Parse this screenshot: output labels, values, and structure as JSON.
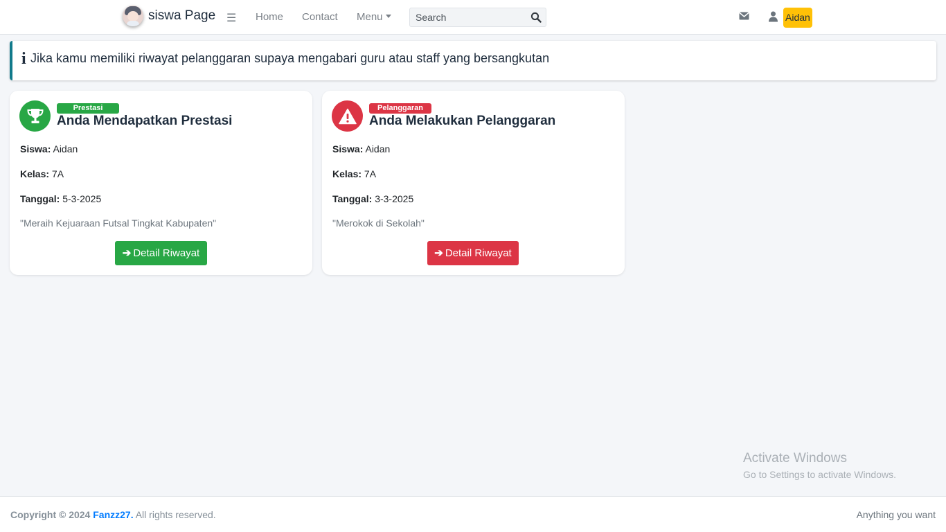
{
  "navbar": {
    "brand": "siswa Page",
    "links": {
      "home": "Home",
      "contact": "Contact",
      "menu": "Menu"
    },
    "search_placeholder": "Search",
    "user_name": "Aidan",
    "icons": [
      "hamburger-icon",
      "caret-down-icon",
      "search-icon",
      "envelope-icon",
      "user-icon"
    ]
  },
  "callout": {
    "icon": "i",
    "text": "Jika kamu memiliki riwayat pelanggaran supaya mengabari guru atau staff yang bersangkutan"
  },
  "cards": [
    {
      "badge": "Prestasi",
      "title": "Anda Mendapatkan Prestasi",
      "labels": {
        "siswa": "Siswa:",
        "kelas": "Kelas:",
        "tanggal": "Tanggal:"
      },
      "siswa": "Aidan",
      "kelas": "7A",
      "tanggal": "5-3-2025",
      "description": "\"Meraih Kejuaraan Futsal Tingkat Kabupaten\"",
      "button_label": "Detail Riwayat",
      "color": "#28a745",
      "icon": "trophy-icon"
    },
    {
      "badge": "Pelanggaran",
      "title": "Anda Melakukan Pelanggaran",
      "labels": {
        "siswa": "Siswa:",
        "kelas": "Kelas:",
        "tanggal": "Tanggal:"
      },
      "siswa": "Aidan",
      "kelas": "7A",
      "tanggal": "3-3-2025",
      "description": "\"Merokok di Sekolah\"",
      "button_label": "Detail Riwayat",
      "color": "#dc3545",
      "icon": "warning-icon"
    }
  ],
  "watermark": {
    "title": "Activate Windows",
    "subtitle": "Go to Settings to activate Windows."
  },
  "footer": {
    "copyright": "Copyright © 2024",
    "author": "Fanzz27.",
    "rights": "All rights reserved.",
    "right_text": "Anything you want"
  }
}
